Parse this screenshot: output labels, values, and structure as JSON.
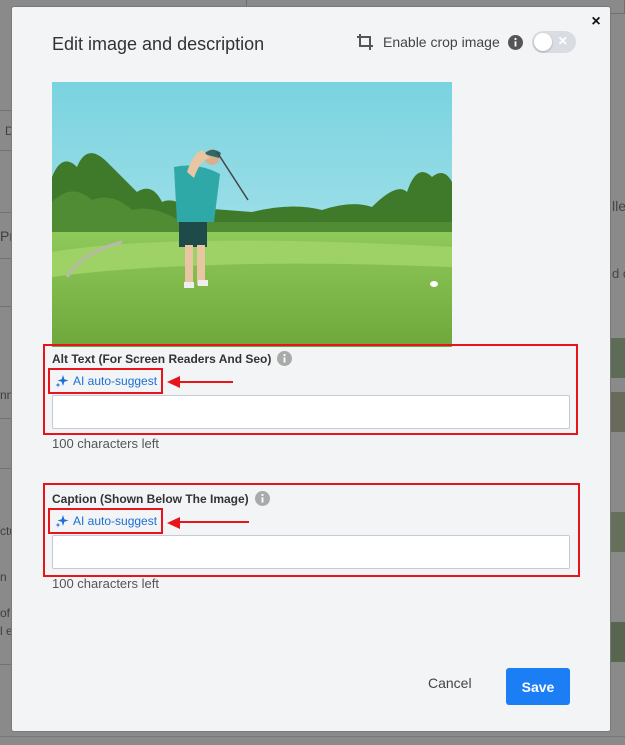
{
  "modal": {
    "title": "Edit image and description",
    "crop": {
      "label": "Enable crop image",
      "enabled": false
    },
    "close_label": "×",
    "alt_text": {
      "label": "Alt Text (For Screen Readers And Seo)",
      "ai_label": "AI auto-suggest",
      "value": "",
      "placeholder": "",
      "chars_left": "100 characters left"
    },
    "caption": {
      "label": "Caption (Shown Below The Image)",
      "ai_label": "AI auto-suggest",
      "value": "",
      "placeholder": "",
      "chars_left": "100 characters left"
    },
    "cancel_label": "Cancel",
    "save_label": "Save"
  },
  "background": {
    "left_fragments": [
      "D",
      "Pr",
      "nn",
      "ctu",
      "n",
      "of",
      "l e"
    ],
    "right_fragments": [
      "lle",
      "d o"
    ]
  },
  "colors": {
    "primary": "#1c7ef5",
    "link": "#1a6fd4",
    "annotation": "#e8141b",
    "modal_bg": "#f3f4f6"
  },
  "icons": [
    "crop-icon",
    "info-icon",
    "close-icon",
    "sparkle-icon",
    "arrow-left-icon"
  ]
}
